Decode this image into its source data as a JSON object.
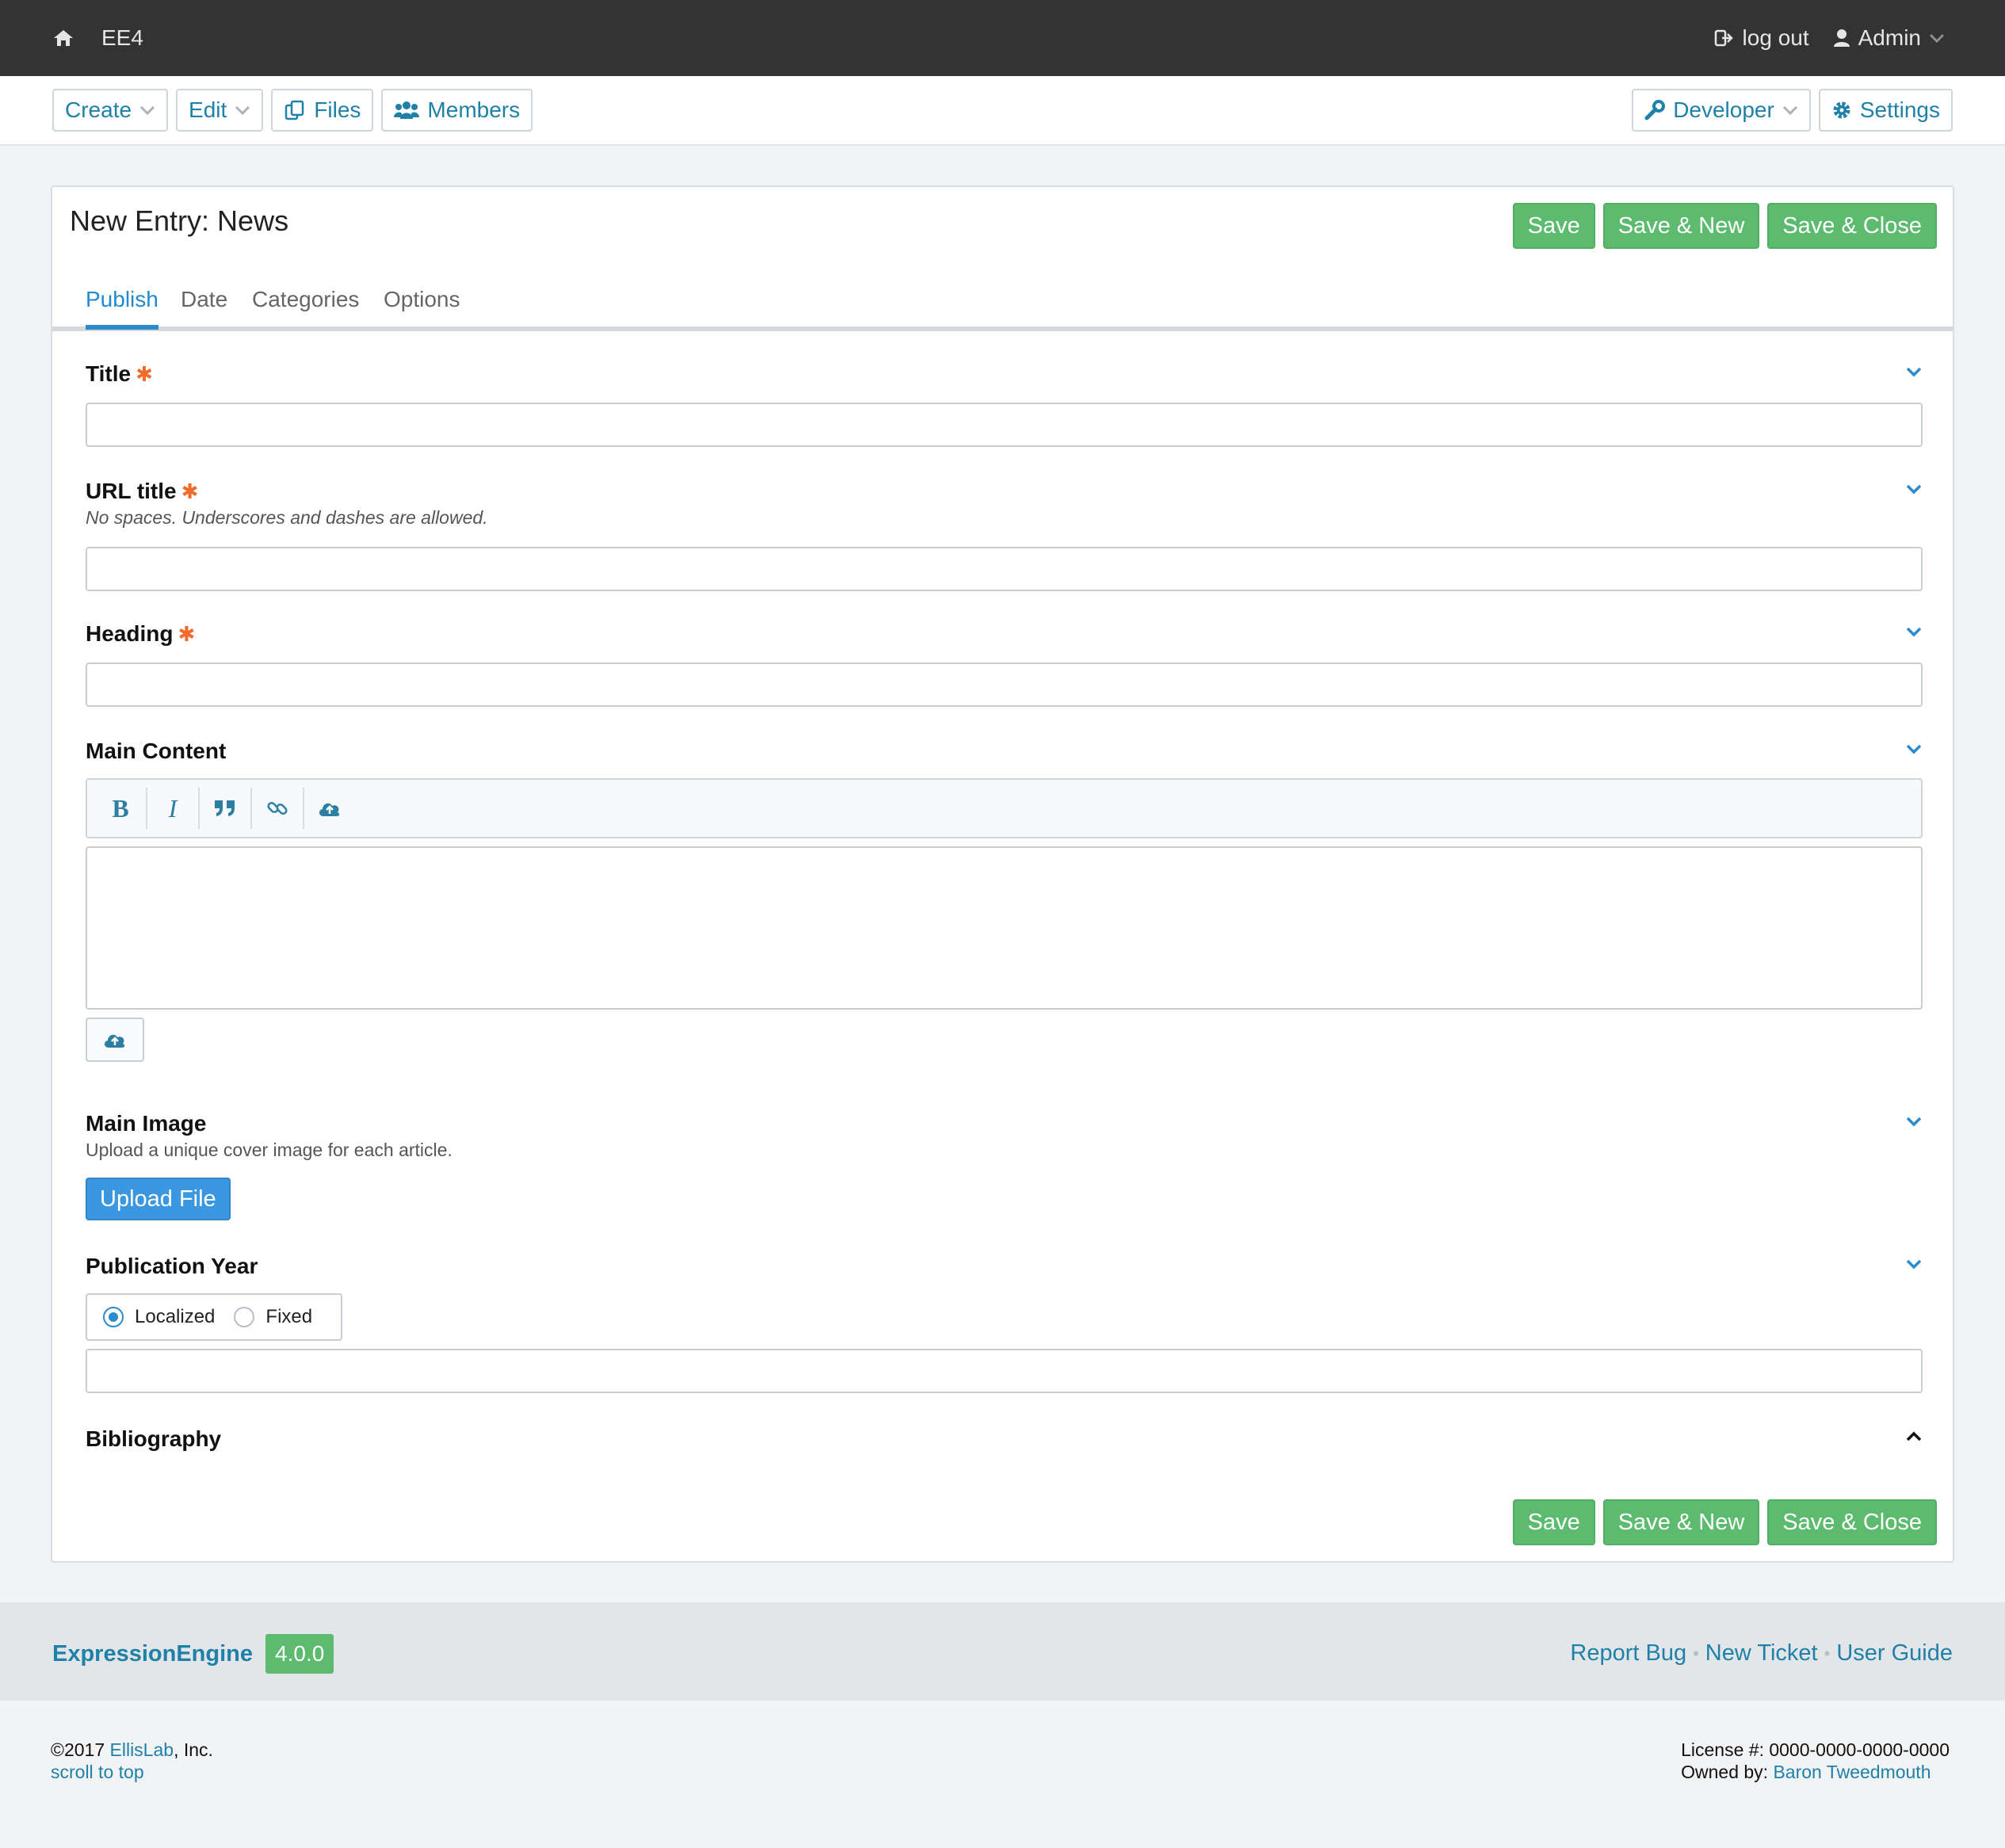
{
  "topbar": {
    "site_name": "EE4",
    "logout_label": "log out",
    "user_label": "Admin",
    "icons": [
      "home-icon",
      "logout-icon",
      "user-icon",
      "chevron-down-icon"
    ]
  },
  "nav": {
    "create": "Create",
    "edit": "Edit",
    "files": "Files",
    "members": "Members",
    "developer": "Developer",
    "settings": "Settings"
  },
  "entry": {
    "title": "New Entry: News",
    "actions": {
      "save": "Save",
      "save_new": "Save & New",
      "save_close": "Save & Close"
    },
    "tabs": [
      "Publish",
      "Date",
      "Categories",
      "Options"
    ],
    "active_tab": "Publish"
  },
  "fields": {
    "title": {
      "label": "Title",
      "required": "✱",
      "value": ""
    },
    "url_title": {
      "label": "URL title",
      "required": "✱",
      "hint": "No spaces. Underscores and dashes are allowed.",
      "value": ""
    },
    "heading": {
      "label": "Heading",
      "required": "✱",
      "value": ""
    },
    "main_content": {
      "label": "Main Content",
      "toolbar": [
        "B",
        "I"
      ],
      "value": ""
    },
    "main_image": {
      "label": "Main Image",
      "hint": "Upload a unique cover image for each article.",
      "button": "Upload File"
    },
    "publication_year": {
      "label": "Publication Year",
      "options": [
        "Localized",
        "Fixed"
      ],
      "selected": "Localized",
      "value": ""
    },
    "bibliography": {
      "label": "Bibliography"
    }
  },
  "footer": {
    "brand": "ExpressionEngine",
    "version": "4.0.0",
    "links": [
      "Report Bug",
      "New Ticket",
      "User Guide"
    ],
    "separator": "•",
    "copyright_prefix": "©2017 ",
    "company": "EllisLab",
    "copyright_suffix": ", Inc.",
    "scroll_top": "scroll to top",
    "license": "License #: 0000-0000-0000-0000",
    "owned_prefix": "Owned by: ",
    "owner": "Baron Tweedmouth"
  },
  "colors": {
    "topbar": "#333333",
    "link": "#1f80a8",
    "save_green": "#5dbb6f",
    "upload_blue": "#3a97e0",
    "required": "#ef6c2b",
    "tab_active": "#1f8ad0"
  }
}
